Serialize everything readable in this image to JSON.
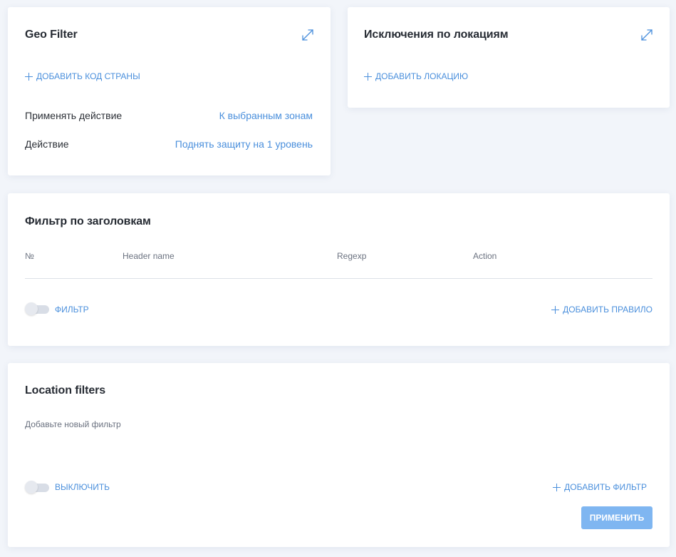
{
  "geo_filter": {
    "title": "Geo Filter",
    "add_country_label": "ДОБАВИТЬ КОД СТРАНЫ",
    "rows": [
      {
        "label": "Применять действие",
        "value": "К выбранным зонам"
      },
      {
        "label": "Действие",
        "value": "Поднять защиту на 1 уровень"
      }
    ]
  },
  "location_exceptions": {
    "title": "Исключения по локациям",
    "add_location_label": "ДОБАВИТЬ ЛОКАЦИЮ"
  },
  "header_filter": {
    "title": "Фильтр по заголовкам",
    "columns": [
      "№",
      "Header name",
      "Regexp",
      "Action"
    ],
    "toggle_label": "ФИЛЬТР",
    "add_rule_label": "ДОБАВИТЬ ПРАВИЛО"
  },
  "location_filters": {
    "title": "Location filters",
    "hint": "Добавьте новый фильтр",
    "toggle_label": "ВЫКЛЮЧИТЬ",
    "add_filter_label": "ДОБАВИТЬ ФИЛЬТР",
    "apply_label": "ПРИМЕНИТЬ"
  },
  "colors": {
    "accent": "#4a8fdc",
    "button": "#7fb6f1",
    "background": "#f2f5fa",
    "card": "#ffffff"
  },
  "icons": {
    "expand": "expand-diagonal-icon",
    "plus": "plus-icon"
  }
}
